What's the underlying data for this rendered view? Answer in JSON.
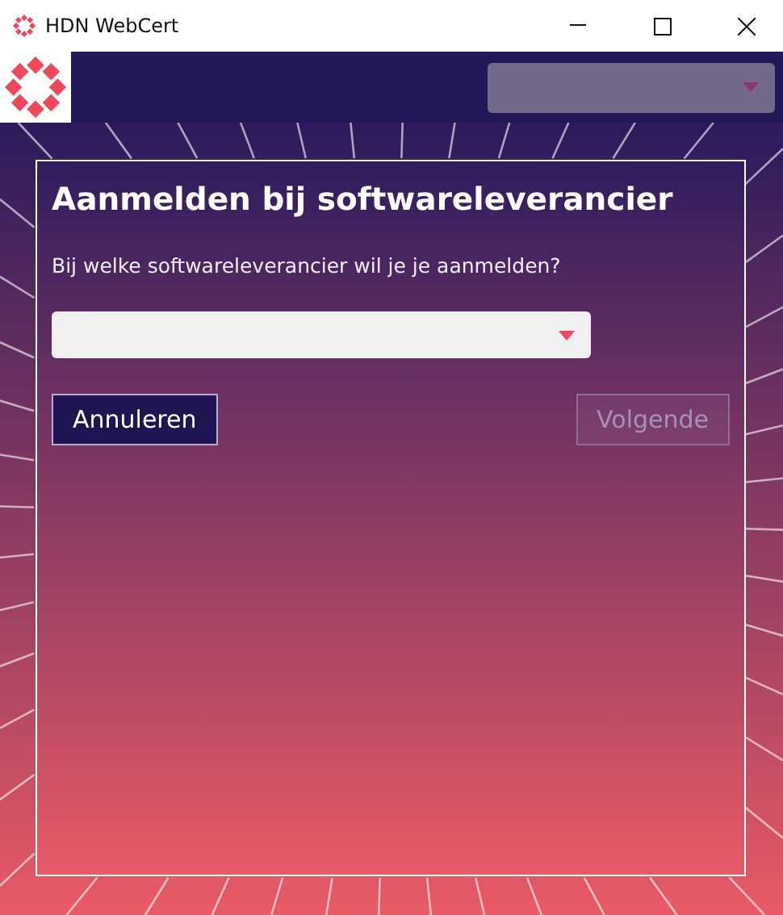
{
  "window": {
    "title": "HDN WebCert"
  },
  "header": {
    "account_select": {
      "disabled": true
    }
  },
  "dialog": {
    "title": "Aanmelden bij softwareleverancier",
    "question": "Bij welke softwareleverancier wil je je aanmelden?",
    "vendor_select": {
      "disabled": false
    },
    "buttons": [
      {
        "label": "Annuleren",
        "kind": "secondary",
        "disabled": false
      },
      {
        "label": "Volgende",
        "kind": "primary",
        "disabled": true
      }
    ]
  }
}
